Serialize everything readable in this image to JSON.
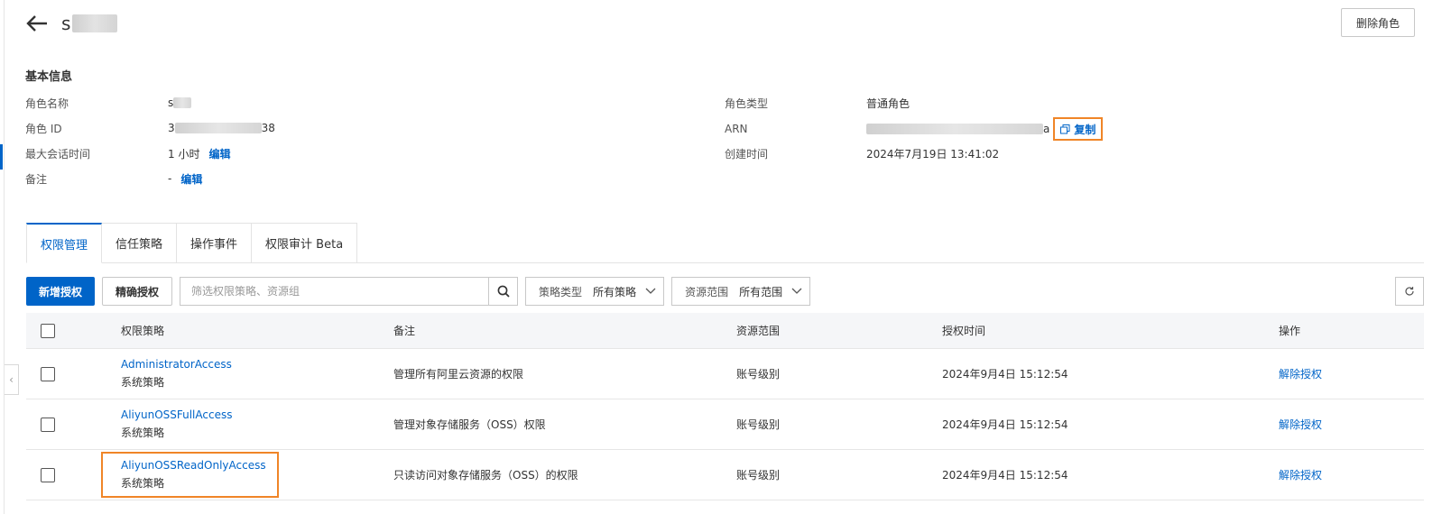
{
  "header": {
    "title_prefix": "s",
    "delete_button": "删除角色"
  },
  "basic_info": {
    "section_title": "基本信息",
    "role_name": {
      "label": "角色名称",
      "value_prefix": "s"
    },
    "role_id": {
      "label": "角色 ID",
      "value_prefix": "3",
      "value_suffix": "38"
    },
    "max_session": {
      "label": "最大会话时间",
      "value": "1 小时",
      "edit": "编辑"
    },
    "remark": {
      "label": "备注",
      "value": "-",
      "edit": "编辑"
    },
    "role_type": {
      "label": "角色类型",
      "value": "普通角色"
    },
    "arn": {
      "label": "ARN",
      "value_suffix": "a",
      "copy": "复制"
    },
    "created": {
      "label": "创建时间",
      "value": "2024年7月19日 13:41:02"
    }
  },
  "tabs": [
    {
      "label": "权限管理",
      "active": true
    },
    {
      "label": "信任策略",
      "active": false
    },
    {
      "label": "操作事件",
      "active": false
    },
    {
      "label": "权限审计 Beta",
      "active": false
    }
  ],
  "toolbar": {
    "add_grant": "新增授权",
    "precise_grant": "精确授权",
    "search_placeholder": "筛选权限策略、资源组",
    "policy_type_label": "策略类型",
    "policy_type_value": "所有策略",
    "scope_label": "资源范围",
    "scope_value": "所有范围"
  },
  "table": {
    "columns": {
      "policy": "权限策略",
      "note": "备注",
      "scope": "资源范围",
      "time": "授权时间",
      "op": "操作"
    },
    "rows": [
      {
        "policy": "AdministratorAccess",
        "type": "系统策略",
        "note": "管理所有阿里云资源的权限",
        "scope": "账号级别",
        "time": "2024年9月4日 15:12:54",
        "op": "解除授权"
      },
      {
        "policy": "AliyunOSSFullAccess",
        "type": "系统策略",
        "note": "管理对象存储服务（OSS）权限",
        "scope": "账号级别",
        "time": "2024年9月4日 15:12:54",
        "op": "解除授权"
      },
      {
        "policy": "AliyunOSSReadOnlyAccess",
        "type": "系统策略",
        "note": "只读访问对象存储服务（OSS）的权限",
        "scope": "账号级别",
        "time": "2024年9月4日 15:12:54",
        "op": "解除授权"
      }
    ]
  },
  "colors": {
    "accent": "#0064c8",
    "highlight": "#f08527"
  }
}
